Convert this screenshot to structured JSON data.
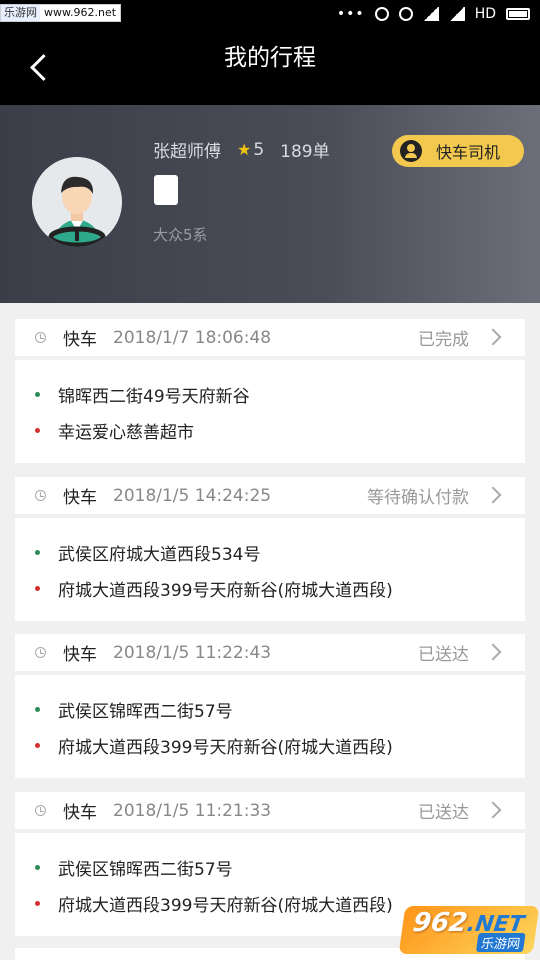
{
  "status_bar": {
    "watermark_left": "乐游网",
    "watermark_url": "www.962.net",
    "network": "HD"
  },
  "header": {
    "title": "我的行程"
  },
  "driver": {
    "name": "张超师傅",
    "rating": "5",
    "orders": "189单",
    "car_model": "大众5系",
    "badge_label": "快车司机"
  },
  "trips": [
    {
      "type": "快车",
      "time": "2018/1/7 18:06:48",
      "status": "已完成",
      "from": "锦晖西二街49号天府新谷",
      "to": "幸运爱心慈善超市"
    },
    {
      "type": "快车",
      "time": "2018/1/5 14:24:25",
      "status": "等待确认付款",
      "from": "武侯区府城大道西段534号",
      "to": "府城大道西段399号天府新谷(府城大道西段)"
    },
    {
      "type": "快车",
      "time": "2018/1/5 11:22:43",
      "status": "已送达",
      "from": "武侯区锦晖西二街57号",
      "to": "府城大道西段399号天府新谷(府城大道西段)"
    },
    {
      "type": "快车",
      "time": "2018/1/5 11:21:33",
      "status": "已送达",
      "from": "武侯区锦晖西二街57号",
      "to": "府城大道西段399号天府新谷(府城大道西段)"
    }
  ],
  "watermark": {
    "brand": "962",
    "net": ".NET",
    "name": "乐游网"
  },
  "colors": {
    "badge": "#f3c84f",
    "start_dot": "#2e8b57",
    "end_dot": "#d32f2f"
  }
}
